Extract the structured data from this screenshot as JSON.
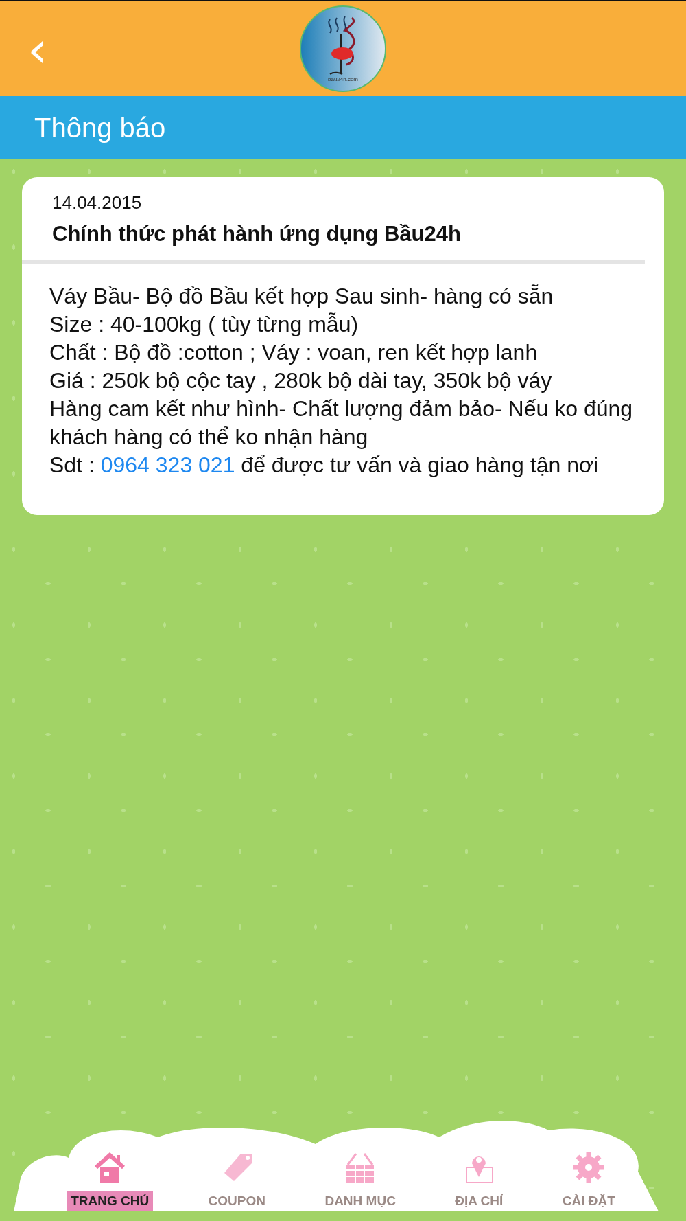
{
  "header": {
    "back": "‹",
    "logo_text": "bau24h.com"
  },
  "title_bar": {
    "title": "Thông báo"
  },
  "notice": {
    "date": "14.04.2015",
    "title": "Chính thức phát hành ứng dụng Bầu24h",
    "lines": [
      {
        "text": "Váy Bầu- Bộ đồ Bầu kết hợp Sau sinh- hàng có sẵn"
      },
      {
        "text": "Size : 40-100kg ( tùy từng mẫu)"
      },
      {
        "text": "Chất : Bộ đồ :cotton ; Váy : voan, ren kết hợp lanh"
      },
      {
        "text": "Giá : 250k bộ cộc tay , 280k bộ dài tay, 350k bộ váy"
      },
      {
        "text": "Hàng cam kết như hình- Chất lượng đảm bảo- Nếu ko đúng khách hàng có thể ko nhận hàng"
      },
      {
        "text": "Sdt : ",
        "link": "0964 323 021",
        "after": " để được tư vấn và giao hàng tận nơi"
      }
    ]
  },
  "tabs": [
    {
      "label": "TRANG CHỦ",
      "kind": "home",
      "selected": true
    },
    {
      "label": "COUPON",
      "kind": "tag",
      "selected": false
    },
    {
      "label": "DANH MỤC",
      "kind": "basket",
      "selected": false
    },
    {
      "label": "ĐỊA CHỈ",
      "kind": "pin",
      "selected": false
    },
    {
      "label": "CÀI ĐẶT",
      "kind": "gear",
      "selected": false
    }
  ]
}
